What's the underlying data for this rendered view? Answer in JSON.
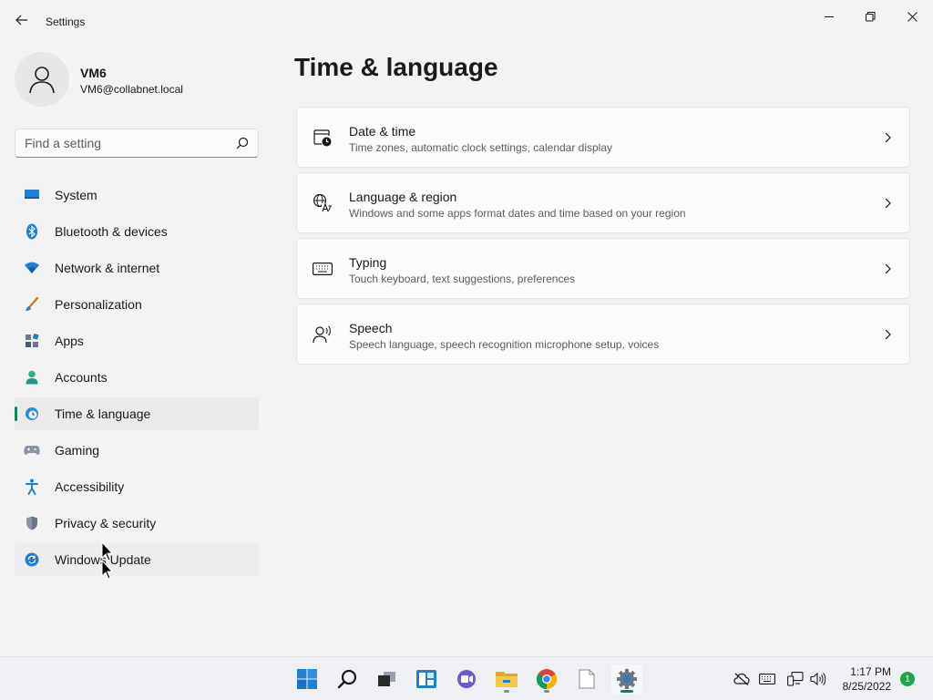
{
  "window": {
    "title": "Settings",
    "minimize_icon": "minimize-icon",
    "maximize_icon": "restore-icon",
    "close_icon": "close-icon"
  },
  "profile": {
    "name": "VM6",
    "email": "VM6@collabnet.local"
  },
  "search": {
    "placeholder": "Find a setting",
    "value": ""
  },
  "sidebar": {
    "items": [
      {
        "label": "System",
        "icon": "system-icon"
      },
      {
        "label": "Bluetooth & devices",
        "icon": "bluetooth-icon"
      },
      {
        "label": "Network & internet",
        "icon": "wifi-icon"
      },
      {
        "label": "Personalization",
        "icon": "brush-icon"
      },
      {
        "label": "Apps",
        "icon": "apps-icon"
      },
      {
        "label": "Accounts",
        "icon": "accounts-icon"
      },
      {
        "label": "Time & language",
        "icon": "globe-clock-icon",
        "selected": true
      },
      {
        "label": "Gaming",
        "icon": "gamepad-icon"
      },
      {
        "label": "Accessibility",
        "icon": "accessibility-icon"
      },
      {
        "label": "Privacy & security",
        "icon": "shield-icon"
      },
      {
        "label": "Windows Update",
        "icon": "update-icon",
        "hovered": true
      }
    ]
  },
  "main": {
    "title": "Time & language",
    "cards": [
      {
        "title": "Date & time",
        "description": "Time zones, automatic clock settings, calendar display",
        "icon": "calendar-clock-icon"
      },
      {
        "title": "Language & region",
        "description": "Windows and some apps format dates and time based on your region",
        "icon": "language-icon"
      },
      {
        "title": "Typing",
        "description": "Touch keyboard, text suggestions, preferences",
        "icon": "keyboard-icon"
      },
      {
        "title": "Speech",
        "description": "Speech language, speech recognition microphone setup, voices",
        "icon": "speech-icon"
      }
    ]
  },
  "taskbar": {
    "apps": [
      "start-icon",
      "search-icon",
      "task-view-icon",
      "widgets-icon",
      "chat-icon",
      "file-explorer-icon",
      "chrome-icon",
      "notepad-icon",
      "settings-icon"
    ],
    "tray": [
      "cloud-offline-icon",
      "keyboard-icon",
      "network-icon",
      "volume-icon"
    ],
    "time": "1:17 PM",
    "date": "8/25/2022",
    "notification_count": "1"
  },
  "colors": {
    "accent": "#0d8a4f",
    "background": "#f3f3f3",
    "card": "#fbfbfb"
  }
}
